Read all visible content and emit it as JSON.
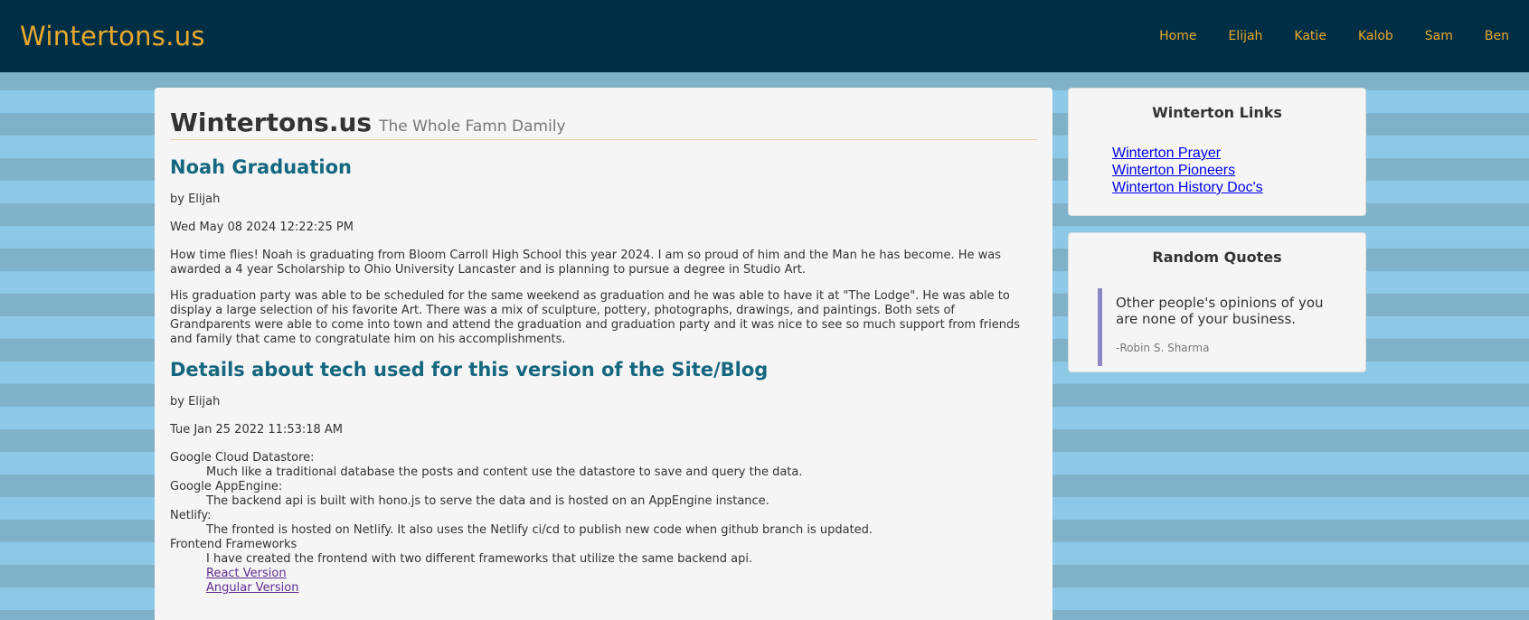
{
  "nav": {
    "brand": "Wintertons.us",
    "links": [
      "Home",
      "Elijah",
      "Katie",
      "Kalob",
      "Sam",
      "Ben"
    ]
  },
  "header": {
    "title": "Wintertons.us",
    "subtitle": "The Whole Famn Damily"
  },
  "posts": [
    {
      "title": "Noah Graduation",
      "author": "by Elijah",
      "date": "Wed May 08 2024 12:22:25 PM",
      "paragraphs": [
        "How time flies! Noah is graduating from Bloom Carroll High School this year 2024. I am so proud of him and the Man he has become. He was awarded a 4 year Scholarship to Ohio University Lancaster and is planning to pursue a degree in Studio Art.",
        "His graduation party was able to be scheduled for the same weekend as graduation and he was able to have it at \"The Lodge\". He was able to display a large selection of his favorite Art. There was a mix of sculpture, pottery, photographs, drawings, and paintings. Both sets of Grandparents were able to come into town and attend the graduation and graduation party and it was nice to see so much support from friends and family that came to congratulate him on his accomplishments."
      ]
    },
    {
      "title": "Details about tech used for this version of the Site/Blog",
      "author": "by Elijah",
      "date": "Tue Jan 25 2022 11:53:18 AM",
      "tech": [
        {
          "term": "Google Cloud Datastore:",
          "desc": "Much like a traditional database the posts and content use the datastore to save and query the data."
        },
        {
          "term": "Google AppEngine:",
          "desc": "The backend api is built with hono.js to serve the data and is hosted on an AppEngine instance."
        },
        {
          "term": "Netlify:",
          "desc": "The fronted is hosted on Netlify. It also uses the Netlify ci/cd to publish new code when github branch is updated."
        },
        {
          "term": "Frontend Frameworks",
          "desc": "I have created the frontend with two different frameworks that utilize the same backend api."
        }
      ],
      "links": [
        "React Version",
        "Angular Version"
      ]
    }
  ],
  "sidebar": {
    "links_title": "Winterton Links",
    "links": [
      "Winterton Prayer",
      "Winterton Pioneers",
      "Winterton History Doc's"
    ],
    "quotes_title": "Random Quotes",
    "quote_text": "Other people's opinions of you are none of your business.",
    "quote_author": "-Robin S. Sharma"
  },
  "colors": {
    "navbar": "#002e44",
    "accent": "#e8a92d",
    "post_title": "#15677f",
    "quote_border": "#8c85c4"
  }
}
